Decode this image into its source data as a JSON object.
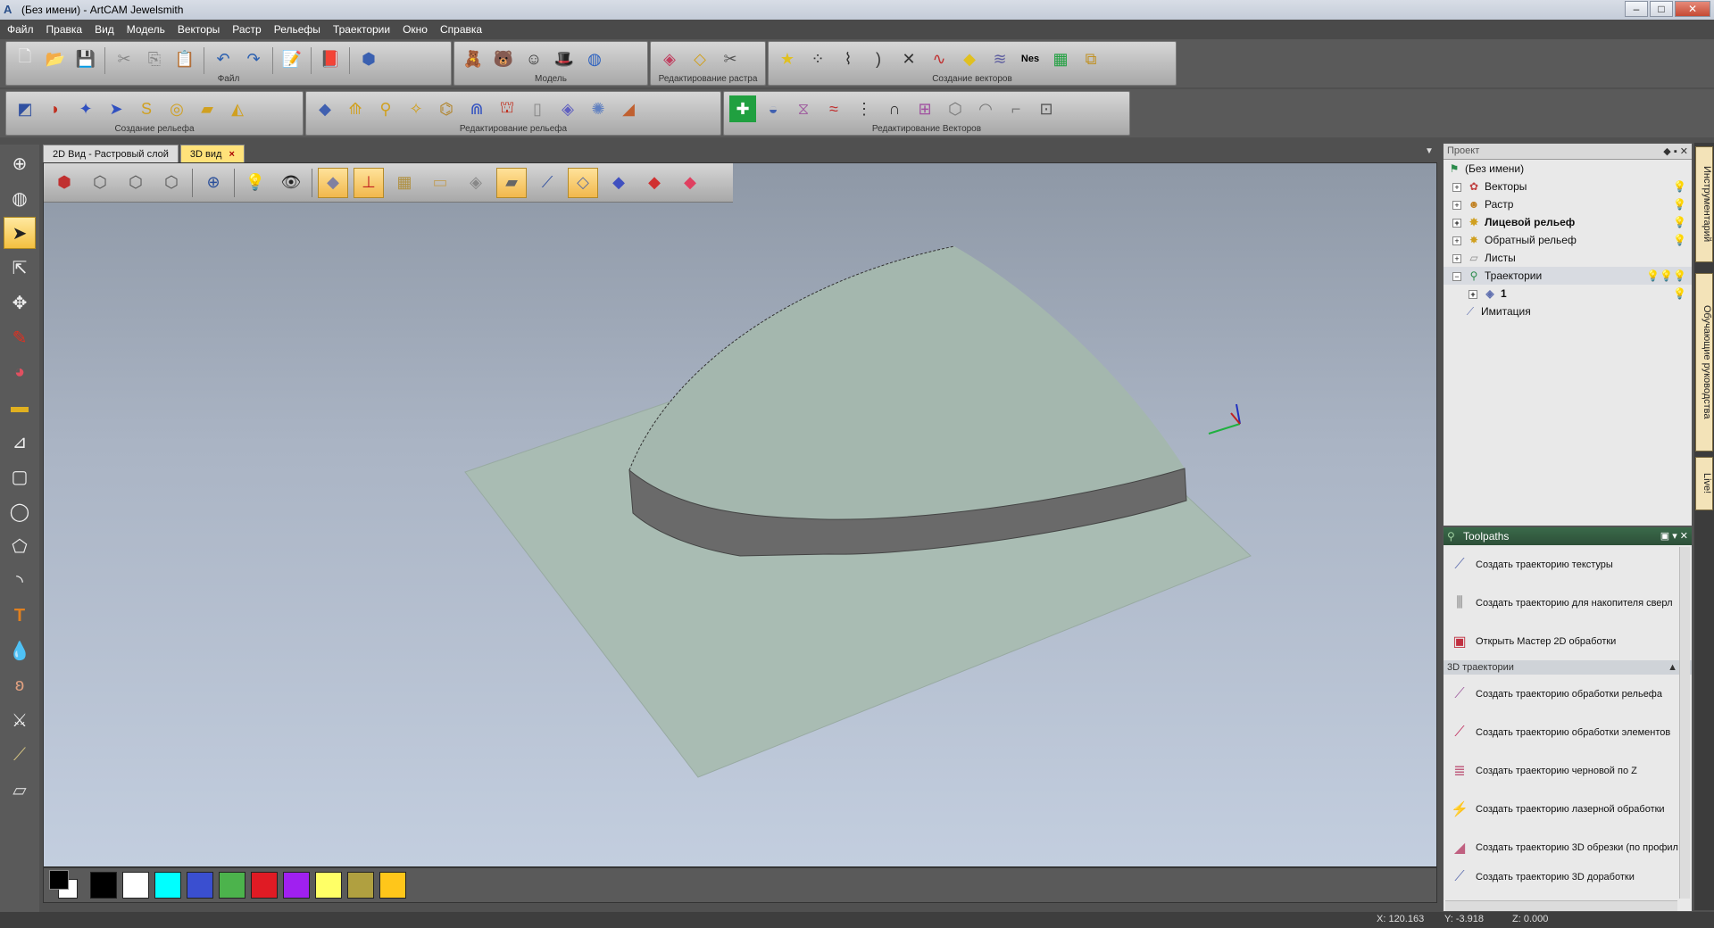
{
  "window": {
    "title": "(Без имени) - ArtCAM Jewelsmith",
    "app_icon": "artcam-logo-icon"
  },
  "menu": [
    "Файл",
    "Правка",
    "Вид",
    "Модель",
    "Векторы",
    "Растр",
    "Рельефы",
    "Траектории",
    "Окно",
    "Справка"
  ],
  "toolbars": {
    "row1": [
      {
        "caption": "Файл",
        "icons": [
          "new-file-icon",
          "open-folder-icon",
          "save-icon",
          "cut-icon",
          "copy-icon",
          "paste-icon",
          "undo-icon",
          "redo-icon",
          "notepad-icon",
          "book-icon",
          "cube-model-icon"
        ]
      },
      {
        "caption": "Модель",
        "icons": [
          "bear-relief-icon",
          "teddy-icon",
          "portrait-icon",
          "hat-icon",
          "sphere-grid-icon"
        ]
      },
      {
        "caption": "Редактирование растра",
        "icons": [
          "eraser-raster-icon",
          "paint-raster-icon",
          "scissors-raster-icon"
        ]
      },
      {
        "caption": "Создание векторов",
        "icons": [
          "star-vector-icon",
          "dots-vector-icon",
          "node-vector-icon",
          "arc-vector-icon",
          "cross-vector-icon",
          "smooth-vector-icon",
          "fill-vector-icon",
          "stack-vector-icon",
          "nesting-icon",
          "grid-vector-icon",
          "layers-vector-icon"
        ]
      }
    ],
    "row2": [
      {
        "caption": "Создание рельефа",
        "icons": [
          "shapes-relief-icon",
          "leaf-relief-icon",
          "star-relief-icon",
          "rotate-relief-icon",
          "s-relief-icon",
          "weave-relief-icon",
          "plane-relief-icon",
          "layers-relief-icon"
        ]
      },
      {
        "caption": "Редактирование рельефа",
        "icons": [
          "flat-relief-icon",
          "spike-relief-icon",
          "spin-relief-icon",
          "twist-relief-icon",
          "cut-relief-icon",
          "arch-relief-icon",
          "lamp-relief-icon",
          "cylinder-relief-icon",
          "plate-relief-icon",
          "drill-relief-icon",
          "bevel-relief-icon"
        ]
      },
      {
        "caption": "Редактирование Векторов",
        "icons": [
          "plus-vector-icon",
          "bowl-vector-icon",
          "mirror-vector-icon",
          "wave-vector-icon",
          "dot-vector-icon",
          "curve-vector-icon",
          "box-vector-icon",
          "rotate-shape-icon",
          "arc-shape-icon",
          "corner-shape-icon",
          "center-shape-icon"
        ]
      }
    ],
    "file_label": "Файл",
    "model_label": "Модель",
    "raster_edit_label": "Редактирование растра",
    "vector_create_label": "Создание векторов",
    "relief_create_label": "Создание рельефа",
    "relief_edit_label": "Редактирование рельефа",
    "vector_edit_label": "Редактирование Векторов"
  },
  "tabs": [
    {
      "label": "2D Вид - Растровый слой",
      "active": false
    },
    {
      "label": "3D вид",
      "active": true
    }
  ],
  "tab_close": "×",
  "view_toolbar": [
    "iso-view-icon",
    "front-view-icon",
    "side-view-icon",
    "top-view-icon",
    "zoom-icon",
    "light-icon",
    "eye-icon",
    "plane-toggle-icon",
    "axes-icon",
    "box-icon",
    "ruler-icon",
    "flat-icon",
    "tool-icon",
    "brush-icon",
    "layer-toggle-icon",
    "relief-blue-icon",
    "relief-red-icon",
    "colorbar-icon"
  ],
  "palette": {
    "colors": [
      "#000000",
      "#ffffff",
      "#00ffff",
      "#3a4fd0",
      "#4cb34c",
      "#e01b24",
      "#a020f0",
      "#ffff66",
      "#b0a040",
      "#ffc61a"
    ],
    "primary": "#000000",
    "secondary": "#ffffff"
  },
  "project": {
    "header": "Проект",
    "root": "(Без имени)",
    "items": [
      {
        "label": "Векторы",
        "icon": "vectors-icon",
        "bold": false,
        "expander": "+"
      },
      {
        "label": "Растр",
        "icon": "raster-icon",
        "bold": false,
        "expander": "+"
      },
      {
        "label": "Лицевой рельеф",
        "icon": "front-relief-icon",
        "bold": true,
        "expander": "+"
      },
      {
        "label": "Обратный рельеф",
        "icon": "back-relief-icon",
        "bold": false,
        "expander": "+"
      },
      {
        "label": "Листы",
        "icon": "sheets-icon",
        "bold": false,
        "expander": "+"
      },
      {
        "label": "Траектории",
        "icon": "toolpaths-icon",
        "bold": false,
        "expander": "−"
      }
    ],
    "child_1": "1",
    "simulation": "Имитация"
  },
  "toolpaths": {
    "header": "Toolpaths",
    "items_2d": [
      {
        "label": "Создать траекторию текстуры",
        "icon": "texture-toolpath-icon"
      },
      {
        "label": "Создать траекторию для накопителя сверл",
        "icon": "drill-bank-icon"
      },
      {
        "label": "Открыть Мастер 2D обработки",
        "icon": "wizard-2d-icon"
      }
    ],
    "section_3d": "3D траектории",
    "items_3d": [
      {
        "label": "Создать траекторию обработки рельефа",
        "icon": "relief-machining-icon"
      },
      {
        "label": "Создать траекторию обработки элементов",
        "icon": "feature-machining-icon"
      },
      {
        "label": "Создать траекторию черновой по Z",
        "icon": "z-rough-icon"
      },
      {
        "label": "Создать траекторию лазерной обработки",
        "icon": "laser-icon"
      },
      {
        "label": "Создать траекторию 3D обрезки (по профил",
        "icon": "trim-3d-icon"
      },
      {
        "label": "Создать траекторию 3D доработки",
        "icon": "rest-3d-icon"
      }
    ]
  },
  "side_tabs": [
    "Инструментарий",
    "Обучающие руководства",
    "Live!"
  ],
  "status": {
    "x": "X: 120.163",
    "y": "Y: -3.918",
    "z": "Z: 0.000"
  }
}
